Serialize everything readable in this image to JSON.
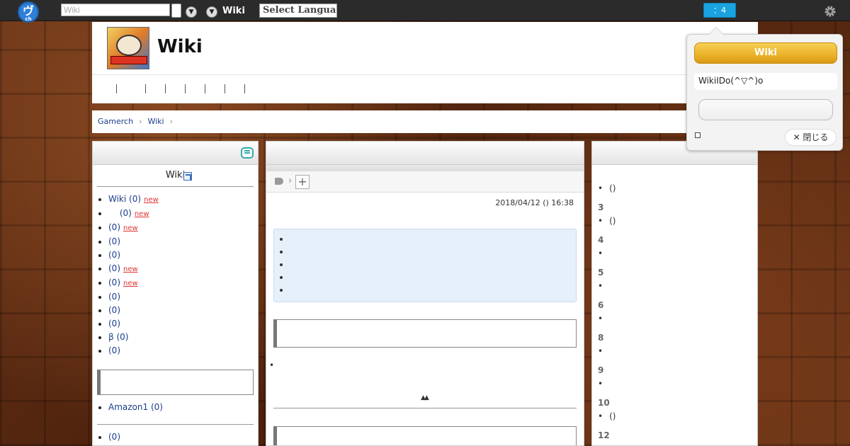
{
  "topbar": {
    "logo_main": "ヴ",
    "logo_sub": "ch",
    "search_placeholder": "Wiki",
    "dropdown_icon": "chevron-down-circle",
    "wiki_label": "Wiki",
    "language_select": "Select Language",
    "notification_label": "：4",
    "settings_icon": "gear"
  },
  "header": {
    "site_title": "Wiki"
  },
  "breadcrumb": {
    "items": [
      "Gamerch",
      "Wiki"
    ],
    "separator": "›"
  },
  "left": {
    "title": "Wiki",
    "menu": [
      {
        "label": "Wiki (0)",
        "new": true
      },
      {
        "label": "　 (0)",
        "new": true
      },
      {
        "label": "(0)",
        "new": true
      },
      {
        "label": "(0)",
        "new": false
      },
      {
        "label": "(0)",
        "new": false
      },
      {
        "label": "(0)",
        "new": true
      },
      {
        "label": "(0)",
        "new": true
      },
      {
        "label": "(0)",
        "new": false
      },
      {
        "label": "(0)",
        "new": false
      },
      {
        "label": "(0)",
        "new": false
      },
      {
        "label": "β (0)",
        "new": false
      },
      {
        "label": "(0)",
        "new": false
      }
    ],
    "new_badge": "new",
    "section2": [
      "Amazon1 (0)"
    ],
    "section3": [
      "(0)"
    ]
  },
  "main": {
    "timestamp": "2018/04/12 () 16:38",
    "toc_items": [
      "",
      "",
      "",
      "",
      ""
    ],
    "page_top_marker": "▲▲",
    "plus_label": "+"
  },
  "right": {
    "ranking": [
      {
        "num": "",
        "text": "()"
      },
      {
        "num": "3",
        "text": "()"
      },
      {
        "num": "4",
        "text": ""
      },
      {
        "num": "5",
        "text": ""
      },
      {
        "num": "6",
        "text": ""
      },
      {
        "num": "8",
        "text": ""
      },
      {
        "num": "9",
        "text": ""
      },
      {
        "num": "10",
        "text": "()"
      },
      {
        "num": "12",
        "text": ""
      }
    ]
  },
  "popup": {
    "wiki_button": "Wiki",
    "message": "WikiIDo(^▽^)o",
    "input_value": "",
    "close_label": "✕ 閉じる"
  },
  "colors": {
    "accent_blue": "#1aa3e0",
    "wiki_button_gold": "#eab22a",
    "link": "#1a3c8c",
    "new_badge": "#dd3333"
  }
}
